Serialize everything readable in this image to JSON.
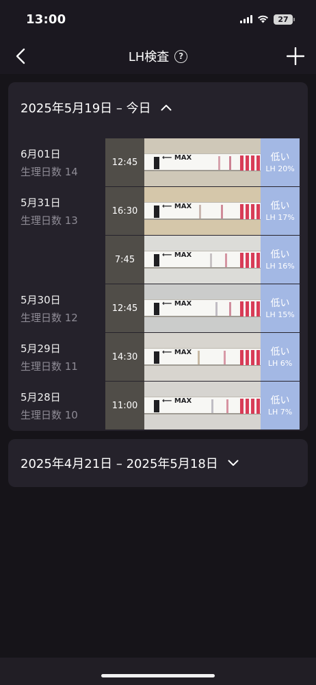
{
  "status": {
    "time": "13:00",
    "battery": "27"
  },
  "nav": {
    "title": "LH検査",
    "help_glyph": "?"
  },
  "current_period": {
    "label": "2025年5月19日 – 今日",
    "expanded": true,
    "entries": [
      {
        "date": "6月01日",
        "cycle_day": "生理日数 14",
        "time": "12:45",
        "level": "低い",
        "lh": "LH 20%"
      },
      {
        "date": "5月31日",
        "cycle_day": "生理日数 13",
        "time": "16:30",
        "level": "低い",
        "lh": "LH 17%"
      },
      {
        "date": "",
        "cycle_day": "",
        "time": "7:45",
        "level": "低い",
        "lh": "LH 16%"
      },
      {
        "date": "5月30日",
        "cycle_day": "生理日数 12",
        "time": "12:45",
        "level": "低い",
        "lh": "LH 15%"
      },
      {
        "date": "5月29日",
        "cycle_day": "生理日数 11",
        "time": "14:30",
        "level": "低い",
        "lh": "LH 6%"
      },
      {
        "date": "5月28日",
        "cycle_day": "生理日数 10",
        "time": "11:00",
        "level": "低い",
        "lh": "LH 7%"
      }
    ],
    "strip_arrow_text": "⟵ MAX"
  },
  "past_period": {
    "label": "2025年4月21日 – 2025年5月18日",
    "expanded": false
  },
  "colors": {
    "background": "#161419",
    "card": "#25222b",
    "result_panel": "#a3b8e4",
    "test_line": "#d83c57"
  }
}
